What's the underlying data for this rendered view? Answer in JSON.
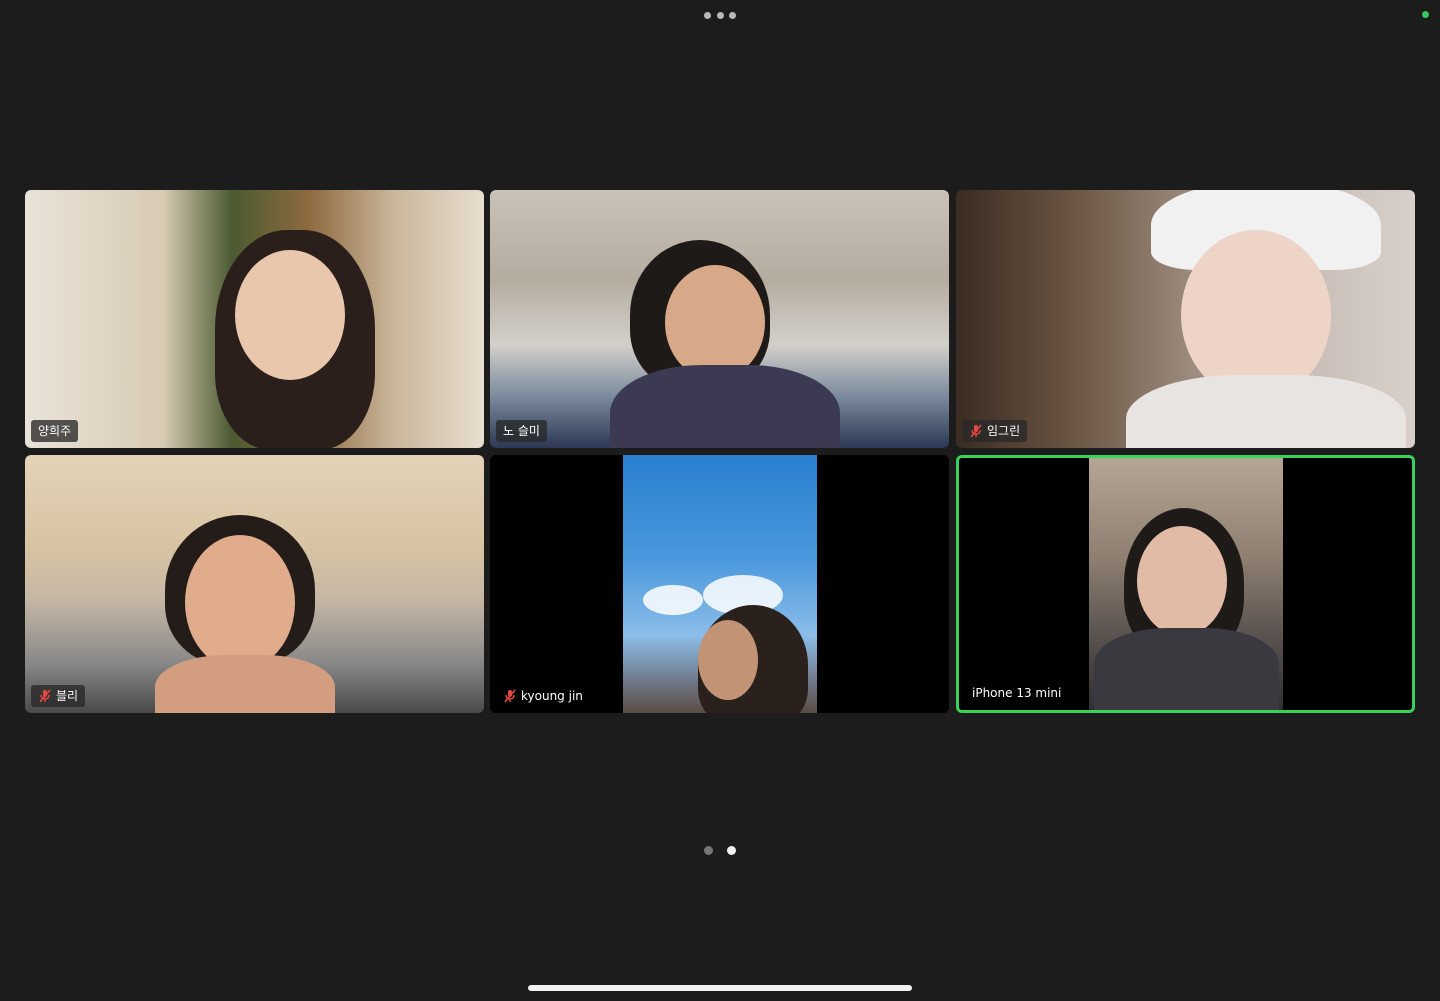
{
  "participants": [
    {
      "name": "양희주",
      "muted": false,
      "active": false
    },
    {
      "name": "노 슬미",
      "muted": false,
      "active": false
    },
    {
      "name": "임그린",
      "muted": true,
      "active": false
    },
    {
      "name": "블리",
      "muted": true,
      "active": false
    },
    {
      "name": "kyoung jin",
      "muted": true,
      "active": false
    },
    {
      "name": "iPhone 13 mini",
      "muted": false,
      "active": true
    }
  ],
  "pagination": {
    "total": 2,
    "current": 2
  },
  "colors": {
    "active_speaker_border": "#3ad35a",
    "mute_icon": "#e5483f",
    "status_dot": "#34c759",
    "page_dot_current": "#f0f0f0",
    "page_dot_other": "#777777"
  },
  "icons": {
    "more": "more-dots-icon",
    "mute": "muted-mic-icon"
  }
}
